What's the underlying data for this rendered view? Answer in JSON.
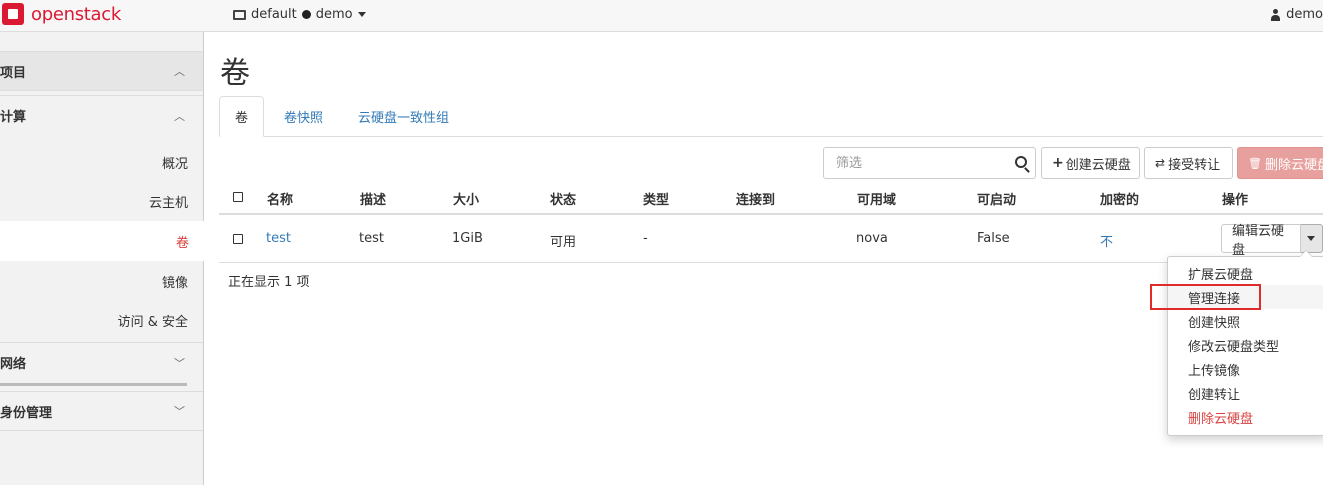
{
  "topbar": {
    "brand": "openstack",
    "domain": "default",
    "project": "demo",
    "user": "demo",
    "brand_color": "#da1a32"
  },
  "sidebar": {
    "sections": {
      "project": "项目",
      "compute": "计算",
      "network": "网络",
      "identity": "身份管理"
    },
    "compute_items": [
      {
        "label": "概况"
      },
      {
        "label": "云主机"
      },
      {
        "label": "卷",
        "active": true
      },
      {
        "label": "镜像"
      },
      {
        "label": "访问 & 安全"
      }
    ]
  },
  "main": {
    "title": "卷",
    "tabs": [
      {
        "label": "卷",
        "active": true
      },
      {
        "label": "卷快照"
      },
      {
        "label": "云硬盘一致性组"
      }
    ],
    "filter_placeholder": "筛选",
    "actions": {
      "create": "创建云硬盘",
      "accept": "接受转让",
      "delete": "删除云硬盘"
    },
    "table": {
      "columns": [
        "名称",
        "描述",
        "大小",
        "状态",
        "类型",
        "连接到",
        "可用域",
        "可启动",
        "加密的",
        "操作"
      ],
      "rows": [
        {
          "name": "test",
          "description": "test",
          "size": "1GiB",
          "status": "可用",
          "type": "-",
          "attached_to": "",
          "zone": "nova",
          "bootable": "False",
          "encrypted": "不",
          "action": "编辑云硬盘"
        }
      ],
      "count_text": "正在显示 1 项"
    },
    "row_menu": [
      {
        "label": "扩展云硬盘"
      },
      {
        "label": "管理连接",
        "highlighted": true
      },
      {
        "label": "创建快照"
      },
      {
        "label": "修改云硬盘类型"
      },
      {
        "label": "上传镜像"
      },
      {
        "label": "创建转让"
      },
      {
        "label": "删除云硬盘",
        "danger": true
      }
    ],
    "colors": {
      "link": "#337ab7",
      "danger": "#d9413e",
      "highlight": "#e02b2b"
    }
  }
}
